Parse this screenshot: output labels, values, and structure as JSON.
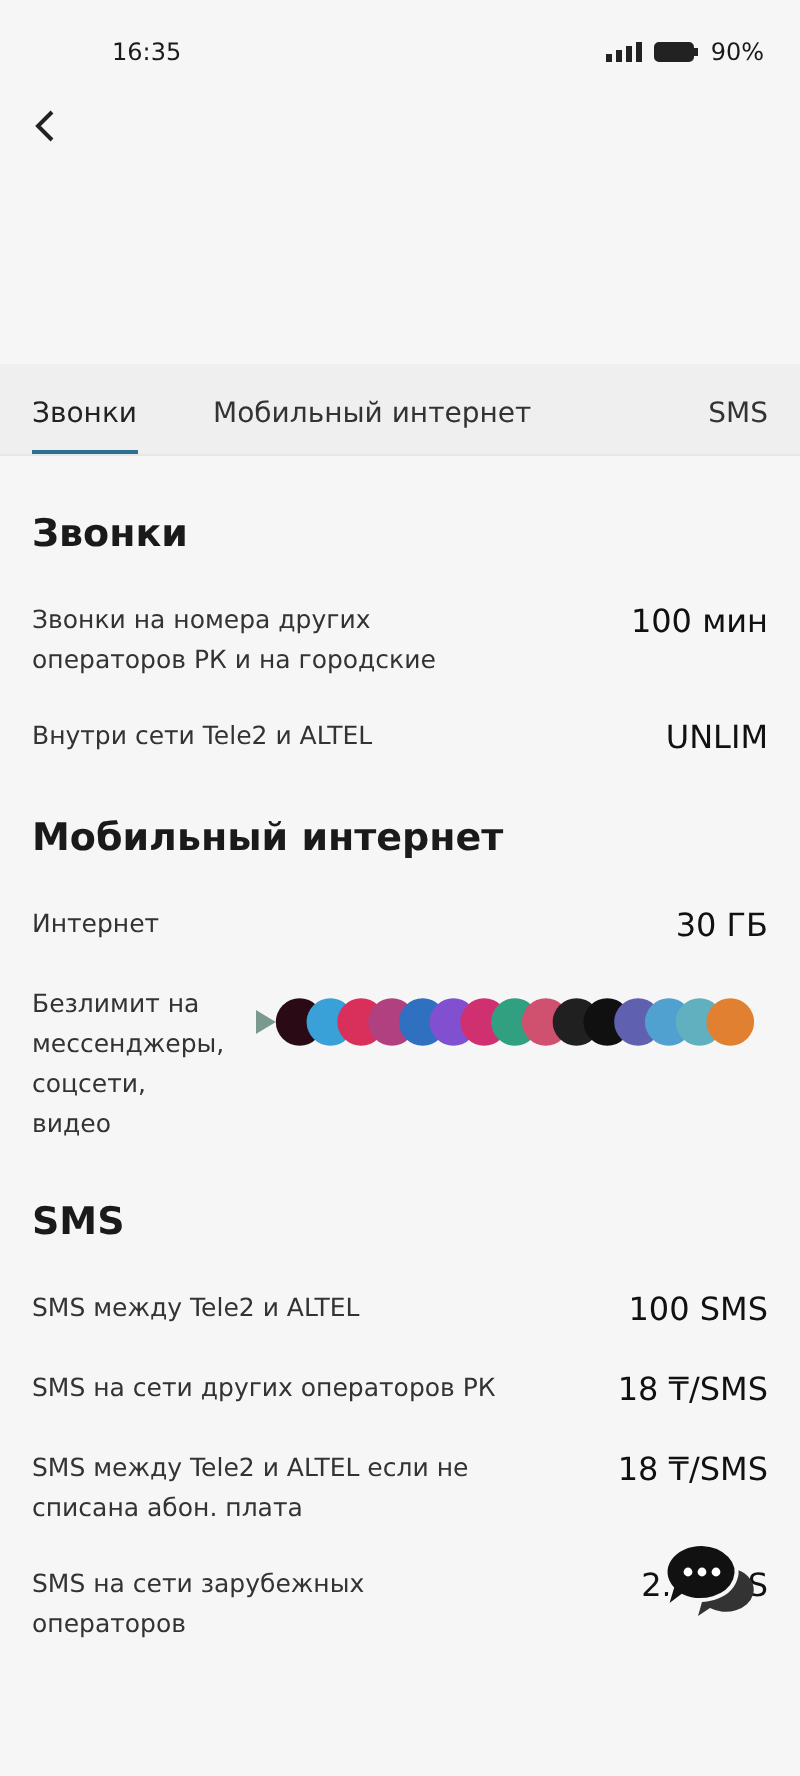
{
  "status_bar": {
    "time": "16:35",
    "battery": "90%"
  },
  "tabs": [
    {
      "label": "Звонки",
      "selected": true
    },
    {
      "label": "Мобильный интернет",
      "selected": false
    },
    {
      "label": "SMS",
      "selected": false
    }
  ],
  "sections": [
    {
      "title": "Звонки",
      "rows": [
        {
          "kind": "text",
          "label": "Звонки на номера других операторов РК и на городские",
          "value": "100 мин"
        },
        {
          "kind": "text",
          "label": "Внутри сети Tele2 и ALTEL",
          "value": "UNLIM"
        }
      ]
    },
    {
      "title": "Мобильный интернет",
      "rows": [
        {
          "kind": "text",
          "label": "Интернет",
          "value": "30 ГБ"
        },
        {
          "kind": "apps",
          "label": "Безлимит на мессенджеры, соцсети, видео"
        }
      ]
    },
    {
      "title": "SMS",
      "rows": [
        {
          "kind": "text",
          "label": "SMS между Tele2 и ALTEL",
          "value": "100 SMS"
        },
        {
          "kind": "text",
          "label": "SMS на сети других операторов РК",
          "value": "18 ₸/SMS"
        },
        {
          "kind": "text",
          "label": "SMS между Tele2 и ALTEL если не списана абон. плата",
          "value": "18 ₸/SMS"
        },
        {
          "kind": "covered",
          "label": "SMS на сети зарубежных операторов",
          "value": "2.",
          "value_tail": "S"
        }
      ]
    }
  ]
}
